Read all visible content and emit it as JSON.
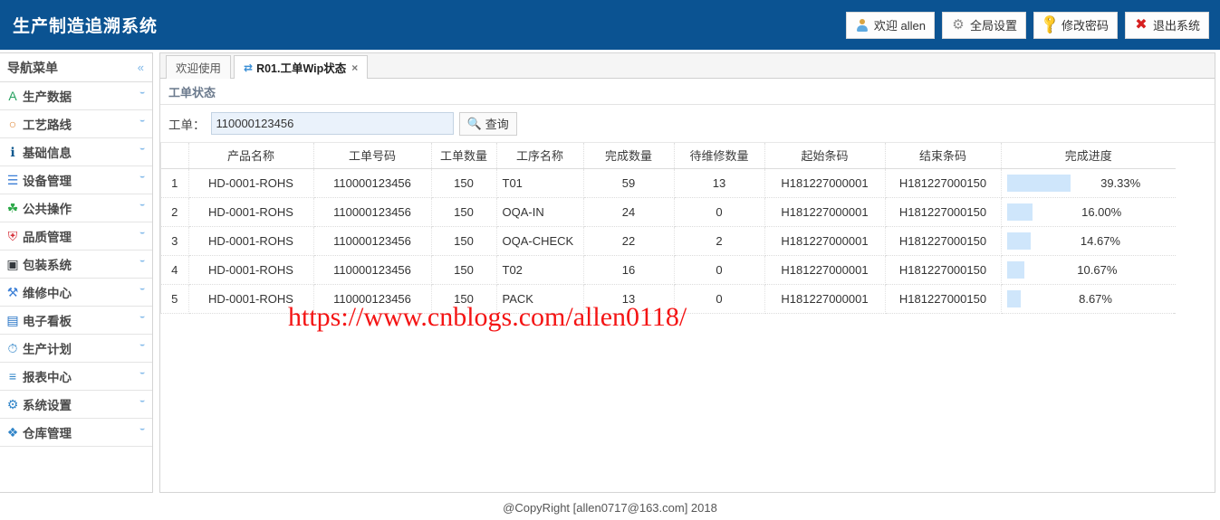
{
  "header": {
    "title": "生产制造追溯系统",
    "bg_color": "#0b5392",
    "buttons": [
      {
        "label": "欢迎 allen",
        "icon": "user-icon"
      },
      {
        "label": "全局设置",
        "icon": "gear-icon"
      },
      {
        "label": "修改密码",
        "icon": "key-icon"
      },
      {
        "label": "退出系统",
        "icon": "close-x-icon"
      }
    ]
  },
  "sidebar": {
    "title": "导航菜单",
    "collapse_icon": "«",
    "expand_icon": "⌄",
    "items": [
      {
        "label": "生产数据",
        "icon": "document-edit-icon",
        "color": "#25a05e"
      },
      {
        "label": "工艺路线",
        "icon": "route-nodes-icon",
        "color": "#e08a3c"
      },
      {
        "label": "基础信息",
        "icon": "info-circle-icon",
        "color": "#11598f"
      },
      {
        "label": "设备管理",
        "icon": "device-list-icon",
        "color": "#3a7ed6"
      },
      {
        "label": "公共操作",
        "icon": "clover-icon",
        "color": "#28a745"
      },
      {
        "label": "品质管理",
        "icon": "shield-icon",
        "color": "#d6303a"
      },
      {
        "label": "包装系统",
        "icon": "package-save-icon",
        "color": "#33383d"
      },
      {
        "label": "维修中心",
        "icon": "tools-icon",
        "color": "#3a7ed6"
      },
      {
        "label": "电子看板",
        "icon": "monitor-icon",
        "color": "#1f6fc4"
      },
      {
        "label": "生产计划",
        "icon": "stopwatch-icon",
        "color": "#2f84c8"
      },
      {
        "label": "报表中心",
        "icon": "report-icon",
        "color": "#2f84c8"
      },
      {
        "label": "系统设置",
        "icon": "settings-gear-icon",
        "color": "#2f84c8"
      },
      {
        "label": "仓库管理",
        "icon": "warehouse-boxes-icon",
        "color": "#2f84c8"
      }
    ]
  },
  "tabs": [
    {
      "label": "欢迎使用",
      "active": false,
      "closable": false,
      "icon": ""
    },
    {
      "label": "R01.工单Wip状态",
      "active": true,
      "closable": true,
      "icon": "exchange-arrows-icon",
      "close_label": "×"
    }
  ],
  "panel": {
    "title": "工单状态"
  },
  "search": {
    "label": "工单：",
    "value": "110000123456",
    "placeholder": "",
    "button_label": "查询",
    "button_icon": "search-icon"
  },
  "grid": {
    "columns": [
      {
        "key": "idx",
        "label": ""
      },
      {
        "key": "product",
        "label": "产品名称"
      },
      {
        "key": "wo",
        "label": "工单号码"
      },
      {
        "key": "wo_qty",
        "label": "工单数量"
      },
      {
        "key": "process",
        "label": "工序名称"
      },
      {
        "key": "done_qty",
        "label": "完成数量"
      },
      {
        "key": "repair_qty",
        "label": "待维修数量"
      },
      {
        "key": "start_barcode",
        "label": "起始条码"
      },
      {
        "key": "end_barcode",
        "label": "结束条码"
      },
      {
        "key": "progress",
        "label": "完成进度"
      }
    ],
    "rows": [
      {
        "idx": "1",
        "product": "HD-0001-ROHS",
        "wo": "110000123456",
        "wo_qty": "150",
        "process": "T01",
        "done_qty": "59",
        "repair_qty": "13",
        "start_barcode": "H181227000001",
        "end_barcode": "H181227000150",
        "progress_text": "39.33%",
        "progress_value": 39.33
      },
      {
        "idx": "2",
        "product": "HD-0001-ROHS",
        "wo": "110000123456",
        "wo_qty": "150",
        "process": "OQA-IN",
        "done_qty": "24",
        "repair_qty": "0",
        "start_barcode": "H181227000001",
        "end_barcode": "H181227000150",
        "progress_text": "16.00%",
        "progress_value": 16.0
      },
      {
        "idx": "3",
        "product": "HD-0001-ROHS",
        "wo": "110000123456",
        "wo_qty": "150",
        "process": "OQA-CHECK",
        "done_qty": "22",
        "repair_qty": "2",
        "start_barcode": "H181227000001",
        "end_barcode": "H181227000150",
        "progress_text": "14.67%",
        "progress_value": 14.67
      },
      {
        "idx": "4",
        "product": "HD-0001-ROHS",
        "wo": "110000123456",
        "wo_qty": "150",
        "process": "T02",
        "done_qty": "16",
        "repair_qty": "0",
        "start_barcode": "H181227000001",
        "end_barcode": "H181227000150",
        "progress_text": "10.67%",
        "progress_value": 10.67
      },
      {
        "idx": "5",
        "product": "HD-0001-ROHS",
        "wo": "110000123456",
        "wo_qty": "150",
        "process": "PACK",
        "done_qty": "13",
        "repair_qty": "0",
        "start_barcode": "H181227000001",
        "end_barcode": "H181227000150",
        "progress_text": "8.67%",
        "progress_value": 8.67
      }
    ],
    "progress_bar_color": "#cfe6fb"
  },
  "watermark": {
    "text": "https://www.cnblogs.com/allen0118/",
    "color": "#f41414"
  },
  "footer": {
    "text": "@CopyRight [allen0717@163.com] 2018"
  }
}
